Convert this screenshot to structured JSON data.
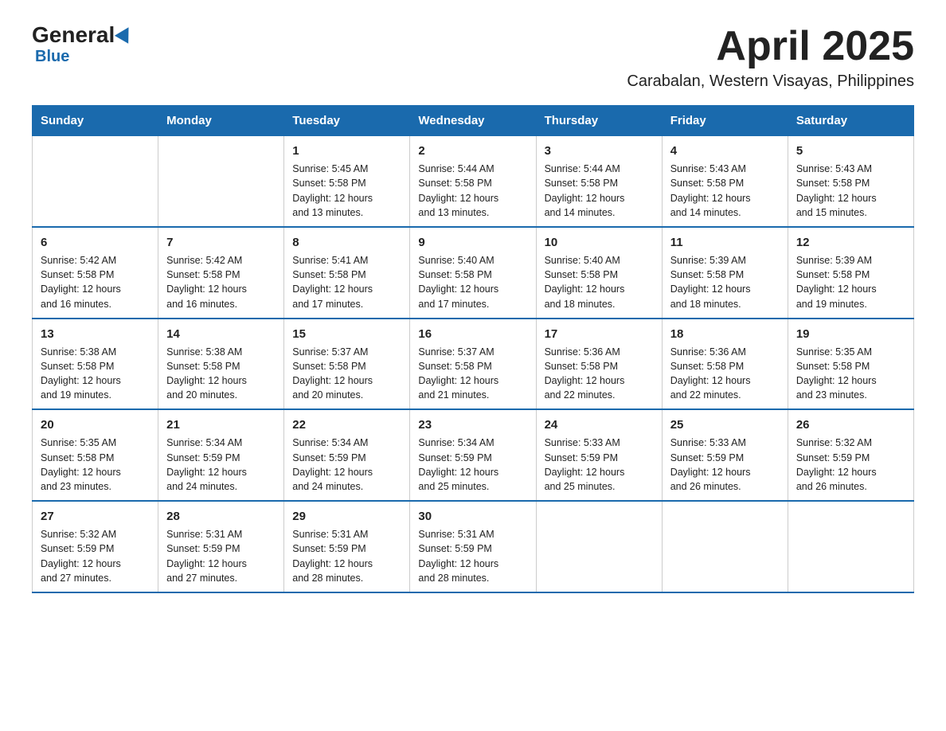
{
  "logo": {
    "general": "General",
    "blue": "Blue"
  },
  "header": {
    "title": "April 2025",
    "subtitle": "Carabalan, Western Visayas, Philippines"
  },
  "columns": [
    "Sunday",
    "Monday",
    "Tuesday",
    "Wednesday",
    "Thursday",
    "Friday",
    "Saturday"
  ],
  "weeks": [
    [
      {
        "day": "",
        "info": ""
      },
      {
        "day": "",
        "info": ""
      },
      {
        "day": "1",
        "info": "Sunrise: 5:45 AM\nSunset: 5:58 PM\nDaylight: 12 hours\nand 13 minutes."
      },
      {
        "day": "2",
        "info": "Sunrise: 5:44 AM\nSunset: 5:58 PM\nDaylight: 12 hours\nand 13 minutes."
      },
      {
        "day": "3",
        "info": "Sunrise: 5:44 AM\nSunset: 5:58 PM\nDaylight: 12 hours\nand 14 minutes."
      },
      {
        "day": "4",
        "info": "Sunrise: 5:43 AM\nSunset: 5:58 PM\nDaylight: 12 hours\nand 14 minutes."
      },
      {
        "day": "5",
        "info": "Sunrise: 5:43 AM\nSunset: 5:58 PM\nDaylight: 12 hours\nand 15 minutes."
      }
    ],
    [
      {
        "day": "6",
        "info": "Sunrise: 5:42 AM\nSunset: 5:58 PM\nDaylight: 12 hours\nand 16 minutes."
      },
      {
        "day": "7",
        "info": "Sunrise: 5:42 AM\nSunset: 5:58 PM\nDaylight: 12 hours\nand 16 minutes."
      },
      {
        "day": "8",
        "info": "Sunrise: 5:41 AM\nSunset: 5:58 PM\nDaylight: 12 hours\nand 17 minutes."
      },
      {
        "day": "9",
        "info": "Sunrise: 5:40 AM\nSunset: 5:58 PM\nDaylight: 12 hours\nand 17 minutes."
      },
      {
        "day": "10",
        "info": "Sunrise: 5:40 AM\nSunset: 5:58 PM\nDaylight: 12 hours\nand 18 minutes."
      },
      {
        "day": "11",
        "info": "Sunrise: 5:39 AM\nSunset: 5:58 PM\nDaylight: 12 hours\nand 18 minutes."
      },
      {
        "day": "12",
        "info": "Sunrise: 5:39 AM\nSunset: 5:58 PM\nDaylight: 12 hours\nand 19 minutes."
      }
    ],
    [
      {
        "day": "13",
        "info": "Sunrise: 5:38 AM\nSunset: 5:58 PM\nDaylight: 12 hours\nand 19 minutes."
      },
      {
        "day": "14",
        "info": "Sunrise: 5:38 AM\nSunset: 5:58 PM\nDaylight: 12 hours\nand 20 minutes."
      },
      {
        "day": "15",
        "info": "Sunrise: 5:37 AM\nSunset: 5:58 PM\nDaylight: 12 hours\nand 20 minutes."
      },
      {
        "day": "16",
        "info": "Sunrise: 5:37 AM\nSunset: 5:58 PM\nDaylight: 12 hours\nand 21 minutes."
      },
      {
        "day": "17",
        "info": "Sunrise: 5:36 AM\nSunset: 5:58 PM\nDaylight: 12 hours\nand 22 minutes."
      },
      {
        "day": "18",
        "info": "Sunrise: 5:36 AM\nSunset: 5:58 PM\nDaylight: 12 hours\nand 22 minutes."
      },
      {
        "day": "19",
        "info": "Sunrise: 5:35 AM\nSunset: 5:58 PM\nDaylight: 12 hours\nand 23 minutes."
      }
    ],
    [
      {
        "day": "20",
        "info": "Sunrise: 5:35 AM\nSunset: 5:58 PM\nDaylight: 12 hours\nand 23 minutes."
      },
      {
        "day": "21",
        "info": "Sunrise: 5:34 AM\nSunset: 5:59 PM\nDaylight: 12 hours\nand 24 minutes."
      },
      {
        "day": "22",
        "info": "Sunrise: 5:34 AM\nSunset: 5:59 PM\nDaylight: 12 hours\nand 24 minutes."
      },
      {
        "day": "23",
        "info": "Sunrise: 5:34 AM\nSunset: 5:59 PM\nDaylight: 12 hours\nand 25 minutes."
      },
      {
        "day": "24",
        "info": "Sunrise: 5:33 AM\nSunset: 5:59 PM\nDaylight: 12 hours\nand 25 minutes."
      },
      {
        "day": "25",
        "info": "Sunrise: 5:33 AM\nSunset: 5:59 PM\nDaylight: 12 hours\nand 26 minutes."
      },
      {
        "day": "26",
        "info": "Sunrise: 5:32 AM\nSunset: 5:59 PM\nDaylight: 12 hours\nand 26 minutes."
      }
    ],
    [
      {
        "day": "27",
        "info": "Sunrise: 5:32 AM\nSunset: 5:59 PM\nDaylight: 12 hours\nand 27 minutes."
      },
      {
        "day": "28",
        "info": "Sunrise: 5:31 AM\nSunset: 5:59 PM\nDaylight: 12 hours\nand 27 minutes."
      },
      {
        "day": "29",
        "info": "Sunrise: 5:31 AM\nSunset: 5:59 PM\nDaylight: 12 hours\nand 28 minutes."
      },
      {
        "day": "30",
        "info": "Sunrise: 5:31 AM\nSunset: 5:59 PM\nDaylight: 12 hours\nand 28 minutes."
      },
      {
        "day": "",
        "info": ""
      },
      {
        "day": "",
        "info": ""
      },
      {
        "day": "",
        "info": ""
      }
    ]
  ]
}
